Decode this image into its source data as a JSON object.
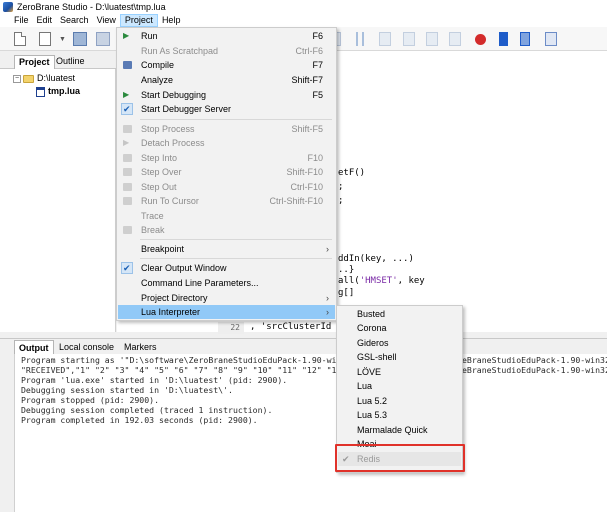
{
  "window": {
    "title": "ZeroBrane Studio - D:\\luatest\\tmp.lua"
  },
  "menubar": {
    "items": [
      "File",
      "Edit",
      "Search",
      "View",
      "Project",
      "Help"
    ]
  },
  "project_panel": {
    "tabs": [
      "Project",
      "Outline"
    ],
    "folder": "D:\\luatest",
    "file": "tmp.lua"
  },
  "editor": {
    "lines": [
      {
        "text": "etF()"
      },
      {
        "text": ";"
      },
      {
        "text": ";"
      },
      {
        "text": "ddIn(key, ...)"
      },
      {
        "text": "..}"
      },
      {
        "pre": "all(",
        "str": "'HMSET'",
        "post": ", key"
      },
      {
        "text": "g[]"
      }
    ],
    "line_number": "22",
    "line_code": ", 'srcClusterId"
  },
  "project_menu": {
    "items": [
      {
        "label": "Run",
        "shortcut": "F6",
        "enabled": true,
        "icon": "run-icon"
      },
      {
        "label": "Run As Scratchpad",
        "shortcut": "Ctrl-F6",
        "enabled": false,
        "icon": ""
      },
      {
        "label": "Compile",
        "shortcut": "F7",
        "enabled": true,
        "icon": "compile-icon"
      },
      {
        "label": "Analyze",
        "shortcut": "Shift-F7",
        "enabled": true,
        "icon": ""
      },
      {
        "label": "Start Debugging",
        "shortcut": "F5",
        "enabled": true,
        "icon": "debug-icon"
      },
      {
        "label": "Start Debugger Server",
        "shortcut": "",
        "enabled": true,
        "icon": "check-icon"
      },
      {
        "label": "Stop Process",
        "shortcut": "Shift-F5",
        "enabled": false,
        "icon": "stop-icon"
      },
      {
        "label": "Detach Process",
        "shortcut": "",
        "enabled": false,
        "icon": "detach-icon"
      },
      {
        "label": "Step Into",
        "shortcut": "F10",
        "enabled": false,
        "icon": "step-into-icon"
      },
      {
        "label": "Step Over",
        "shortcut": "Shift-F10",
        "enabled": false,
        "icon": "step-over-icon"
      },
      {
        "label": "Step Out",
        "shortcut": "Ctrl-F10",
        "enabled": false,
        "icon": "step-out-icon"
      },
      {
        "label": "Run To Cursor",
        "shortcut": "Ctrl-Shift-F10",
        "enabled": false,
        "icon": "run-to-cursor-icon"
      },
      {
        "label": "Trace",
        "shortcut": "",
        "enabled": false,
        "icon": ""
      },
      {
        "label": "Break",
        "shortcut": "",
        "enabled": false,
        "icon": "pause-icon"
      },
      {
        "label": "Breakpoint",
        "shortcut": "",
        "enabled": true,
        "icon": "",
        "submenu": true
      },
      {
        "label": "Clear Output Window",
        "shortcut": "",
        "enabled": true,
        "icon": "check-icon"
      },
      {
        "label": "Command Line Parameters...",
        "shortcut": "",
        "enabled": true,
        "icon": ""
      },
      {
        "label": "Project Directory",
        "shortcut": "",
        "enabled": true,
        "icon": "",
        "submenu": true
      },
      {
        "label": "Lua Interpreter",
        "shortcut": "",
        "enabled": true,
        "icon": "",
        "submenu": true,
        "highlighted": true
      }
    ]
  },
  "interpreter_menu": {
    "items": [
      "Busted",
      "Corona",
      "Gideros",
      "GSL-shell",
      "LÖVE",
      "Lua",
      "Lua 5.2",
      "Lua 5.3",
      "Marmalade Quick",
      "Moai",
      "Redis"
    ],
    "selected": "Redis"
  },
  "output_panel": {
    "tabs": [
      "Output",
      "Local console",
      "Markers"
    ],
    "lines": [
      "Program starting as '\"D:\\software\\ZeroBraneStudioEduPack-1.90-win32",
      "\"RECEIVED\",\"1\" \"2\" \"3\" \"4\" \"5\" \"6\" \"7\" \"8\" \"9\" \"10\" \"11\" \"12\" \"13\"",
      "Program 'lua.exe' started in 'D:\\luatest' (pid: 2900).",
      "Debugging session started in 'D:\\luatest\\'.",
      "Program stopped (pid: 2900).",
      "Debugging session completed (traced 1 instruction).",
      "Program completed in 192.03 seconds (pid: 2900)."
    ],
    "right_snippet": "eBraneStudioEduPack-1.90-win32"
  },
  "colors": {
    "highlight": "#91c9f7",
    "annotation_box": "#e0322a"
  }
}
